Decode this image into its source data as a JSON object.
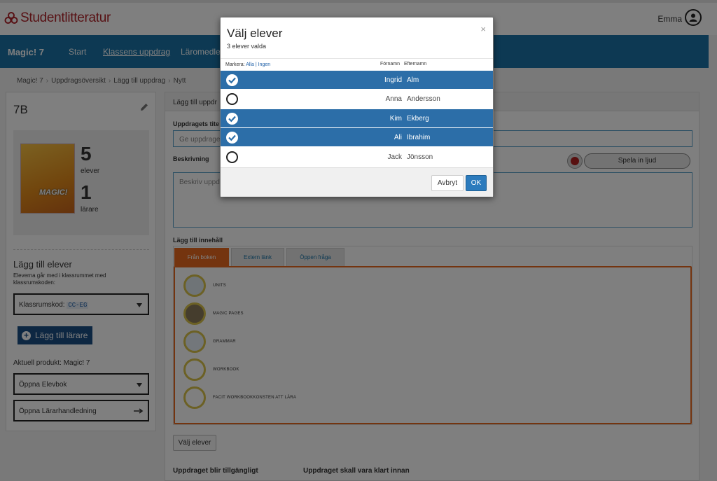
{
  "header": {
    "brand": "Studentlitteratur",
    "user_name": "Emma"
  },
  "nav": {
    "product": "Magic! 7",
    "items": [
      {
        "label": "Start"
      },
      {
        "label": "Klassens uppdrag"
      },
      {
        "label": "Läromedlets"
      }
    ]
  },
  "breadcrumb": [
    "Magic! 7",
    "Uppdragsöversikt",
    "Lägg till uppdrag",
    "Nytt"
  ],
  "class_panel": {
    "class_name": "7B",
    "students_count": "5",
    "students_label": "elever",
    "teachers_count": "1",
    "teachers_label": "lärare",
    "book_logo": "MAGIC!",
    "add_students_title": "Lägg till elever",
    "add_students_text": "Eleverna går med i klassrummet med klassrumskoden:",
    "class_code_label": "Klassrumskod:",
    "class_code": "CC-EG",
    "add_teacher_label": "Lägg till lärare",
    "current_product": "Aktuell produkt: Magic! 7",
    "open_student_book": "Öppna Elevbok",
    "open_teacher_guide": "Öppna Lärarhandledning"
  },
  "form": {
    "header": "Lägg till uppdr",
    "title_label": "Uppdragets tite",
    "title_placeholder": "Ge uppdraget",
    "description_label": "Beskrivning",
    "description_placeholder": "Beskriv uppd",
    "record_button": "Spela in ljud",
    "add_content_label": "Lägg till innehåll",
    "tabs": [
      {
        "label": "Från boken"
      },
      {
        "label": "Extern länk"
      },
      {
        "label": "Öppen fråga"
      }
    ],
    "content_items": [
      {
        "label": "UNITS"
      },
      {
        "label": "MAGIC PAGES"
      },
      {
        "label": "GRAMMAR"
      },
      {
        "label": "WORKBOOK"
      },
      {
        "label": "FACIT WORKBOOKKONSTEN ATT LÄRA"
      }
    ],
    "choose_students_button": "Välj elever",
    "available_label": "Uppdraget blir tillgängligt",
    "due_label": "Uppdraget skall vara klart innan"
  },
  "modal": {
    "title": "Välj elever",
    "subtitle": "3 elever valda",
    "close": "×",
    "mark_label": "Markera:",
    "mark_all": "Alla",
    "mark_none": "Ingen",
    "col_first": "Förnamn",
    "col_last": "Efternamn",
    "students": [
      {
        "first": "Ingrid",
        "last": "Alm",
        "selected": true
      },
      {
        "first": "Anna",
        "last": "Andersson",
        "selected": false
      },
      {
        "first": "Kim",
        "last": "Ekberg",
        "selected": true
      },
      {
        "first": "Ali",
        "last": "Ibrahim",
        "selected": true
      },
      {
        "first": "Jack",
        "last": "Jönsson",
        "selected": false
      }
    ],
    "cancel": "Avbryt",
    "ok": "OK"
  },
  "colors": {
    "brand_red": "#b0242a",
    "nav_blue": "#1a73a6",
    "selected_row": "#2c6ea8",
    "tab_orange": "#e8691e"
  }
}
